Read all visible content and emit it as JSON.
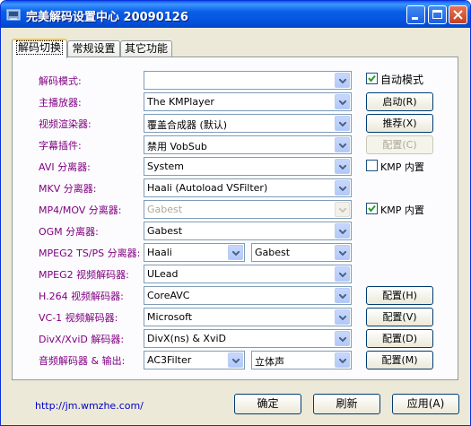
{
  "window": {
    "title": "完美解码设置中心  20090126"
  },
  "tabs": [
    {
      "label": "解码切换"
    },
    {
      "label": "常规设置"
    },
    {
      "label": "其它功能"
    }
  ],
  "rows": [
    {
      "label": "解码模式:",
      "combo1": ""
    },
    {
      "label": "主播放器:",
      "combo1": "The KMPlayer"
    },
    {
      "label": "视频渲染器:",
      "combo1": "覆盖合成器 (默认)"
    },
    {
      "label": "字幕插件:",
      "combo1": "禁用 VobSub"
    },
    {
      "label": "AVI 分离器:",
      "combo1": "System"
    },
    {
      "label": "MKV 分离器:",
      "combo1": "Haali (Autoload VSFilter)"
    },
    {
      "label": "MP4/MOV 分离器:",
      "combo1": "Gabest"
    },
    {
      "label": "OGM 分离器:",
      "combo1": "Gabest"
    },
    {
      "label": "MPEG2 TS/PS 分离器:",
      "combo1": "Haali",
      "combo2": "Gabest"
    },
    {
      "label": "MPEG2 视频解码器:",
      "combo1": "ULead"
    },
    {
      "label": "H.264 视频解码器:",
      "combo1": "CoreAVC"
    },
    {
      "label": "VC-1 视频解码器:",
      "combo1": "Microsoft"
    },
    {
      "label": "DivX/XviD 解码器:",
      "combo1": "DivX(ns) & XviD"
    },
    {
      "label": "音频解码器 & 输出:",
      "combo1": "AC3Filter",
      "combo2": "立体声"
    }
  ],
  "side": {
    "auto_mode": {
      "label": "自动模式",
      "checked": true
    },
    "start_button": "启动(R)",
    "recommend_button": "推荐(X)",
    "config_subtitle_button": "配置(C)",
    "avi_kmp_builtin": {
      "label": "KMP 内置",
      "checked": false
    },
    "mp4_kmp_builtin": {
      "label": "KMP 内置",
      "checked": true
    },
    "config_h264_button": "配置(H)",
    "config_vc1_button": "配置(V)",
    "config_divx_button": "配置(D)",
    "config_audio_button": "配置(M)"
  },
  "footer": {
    "link": "http://jm.wmzhe.com/",
    "ok_button": "确定",
    "refresh_button": "刷新",
    "apply_button": "应用(A)"
  }
}
